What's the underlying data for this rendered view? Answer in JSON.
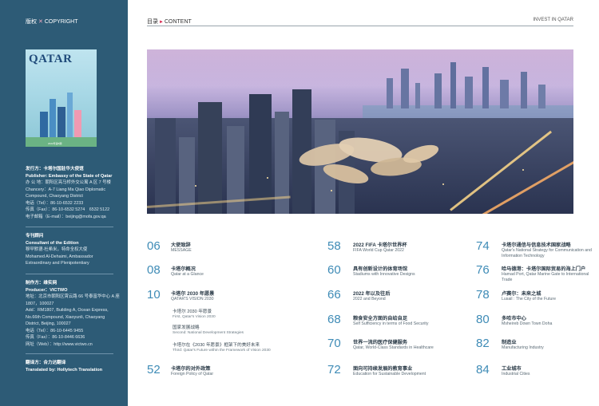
{
  "sidebar": {
    "header_zh": "版权",
    "header_en": "COPYRIGHT",
    "cover": {
      "title": "QATAR",
      "footer": "2022年第5期"
    },
    "publisher": {
      "label_zh": "发行方：卡塔尔国驻华大使馆",
      "label_en": "Publisher: Embassy of the State of Qatar",
      "lines": [
        "办 公 地：朝阳区亮马桥外交公寓 A 区 7 号楼",
        "Chancery：A-7 Liang Ma Qiao Diplomatic",
        "Compound, Chaoyang District",
        "电话（Tel）：86-10-6532 2233",
        "传真（Fax）：86-10-6532 5274　6532 5122",
        "电子邮箱（E-mail）：beijing@mofa.gov.qa"
      ]
    },
    "consultant": {
      "label_zh": "专刊顾问",
      "label_en": "Consultant of the Edition",
      "lines": [
        "穆罕默德·杜希米，特命全权大使",
        "Mohamed Al-Dehaimi, Ambassador",
        "Extraordinary and Plenipotentiary"
      ]
    },
    "producer": {
      "label_zh": "制作方：维实网",
      "label_en": "Producer：VICTWO",
      "lines": [
        "地址：北京市朝阳区霄云路 66 号泰富华中心 A 座",
        "1807，100027",
        "Add：RM1807, Building A, Ocean Express,",
        "No.66th Compound, Xiaoyunli, Chaoyang",
        "District, Beijing, 100027",
        "电话（Tel）：86-10-6445 9455",
        "传真（Fax）：86-10-8446 6636",
        "网址（Web）：http://www.victwo.cn"
      ]
    },
    "translator": {
      "label_zh": "翻译方：合力达翻译",
      "label_en": "Translated by: Hollytech Translation"
    }
  },
  "header": {
    "content_zh": "目录",
    "content_arrow": "►",
    "content_en": "CONTENT",
    "right_label": "INVEST IN QATAR"
  },
  "toc": [
    {
      "page": "06",
      "zh": "大使致辞",
      "en": "MESSAGE"
    },
    {
      "page": "08",
      "zh": "卡塔尔概况",
      "en": "Qatar at a Glance"
    },
    {
      "page": "10",
      "zh": "卡塔尔 2030 年愿景",
      "en": "QATAR'S VISION 2030"
    },
    {
      "page": "52",
      "zh": "卡塔尔的对外政策",
      "en": "Foreign Policy of Qatar"
    },
    {
      "page": "58",
      "zh": "2022 FIFA 卡塔尔世界杯",
      "en": "FIFA World Cup Qatar 2022"
    },
    {
      "page": "60",
      "zh": "具有创新设计的体育场馆",
      "en": "Stadiums with Innovative Designs"
    },
    {
      "page": "66",
      "zh": "2022 年以及往后",
      "en": "2022 and Beyond"
    },
    {
      "page": "68",
      "zh": "粮食安全方面的自给自足",
      "en": "Self Sufficiency in terms of Food Security"
    },
    {
      "page": "70",
      "zh": "世界一流的医疗保健服务",
      "en": "Qatar, World-Class Standards in Healthcare"
    },
    {
      "page": "72",
      "zh": "面向可持续发展的教育事业",
      "en": "Education for Sustainable Development"
    },
    {
      "page": "74",
      "zh": "卡塔尔通信与信息技术国家战略",
      "en": "Qatar's National Strategy for Communication and Information Technology"
    },
    {
      "page": "76",
      "zh": "哈马德港：卡塔尔国际贸易的海上门户",
      "en": "Hamad Port, Qatar Marine Gate to International Trade"
    },
    {
      "page": "78",
      "zh": "卢赛尔：未来之城",
      "en": "Lusail : The City of the Future"
    },
    {
      "page": "80",
      "zh": "多哈市中心",
      "en": "Msheireb Down Town Doha"
    },
    {
      "page": "82",
      "zh": "制造业",
      "en": "Manufacturing Industry"
    },
    {
      "page": "84",
      "zh": "工业城市",
      "en": "Industrial Cities"
    }
  ],
  "vision_subitems": [
    {
      "zh": "卡塔尔 2030 年愿景",
      "en": "First, Qatar's Vision 2030"
    },
    {
      "zh": "国家发展战略",
      "en": "Second: National Development Strategies"
    },
    {
      "zh": "卡塔尔在《2030 年愿景》框架下的美好未来",
      "en": "Third: Qatar's Future within the Framework of Vision 2030"
    }
  ]
}
